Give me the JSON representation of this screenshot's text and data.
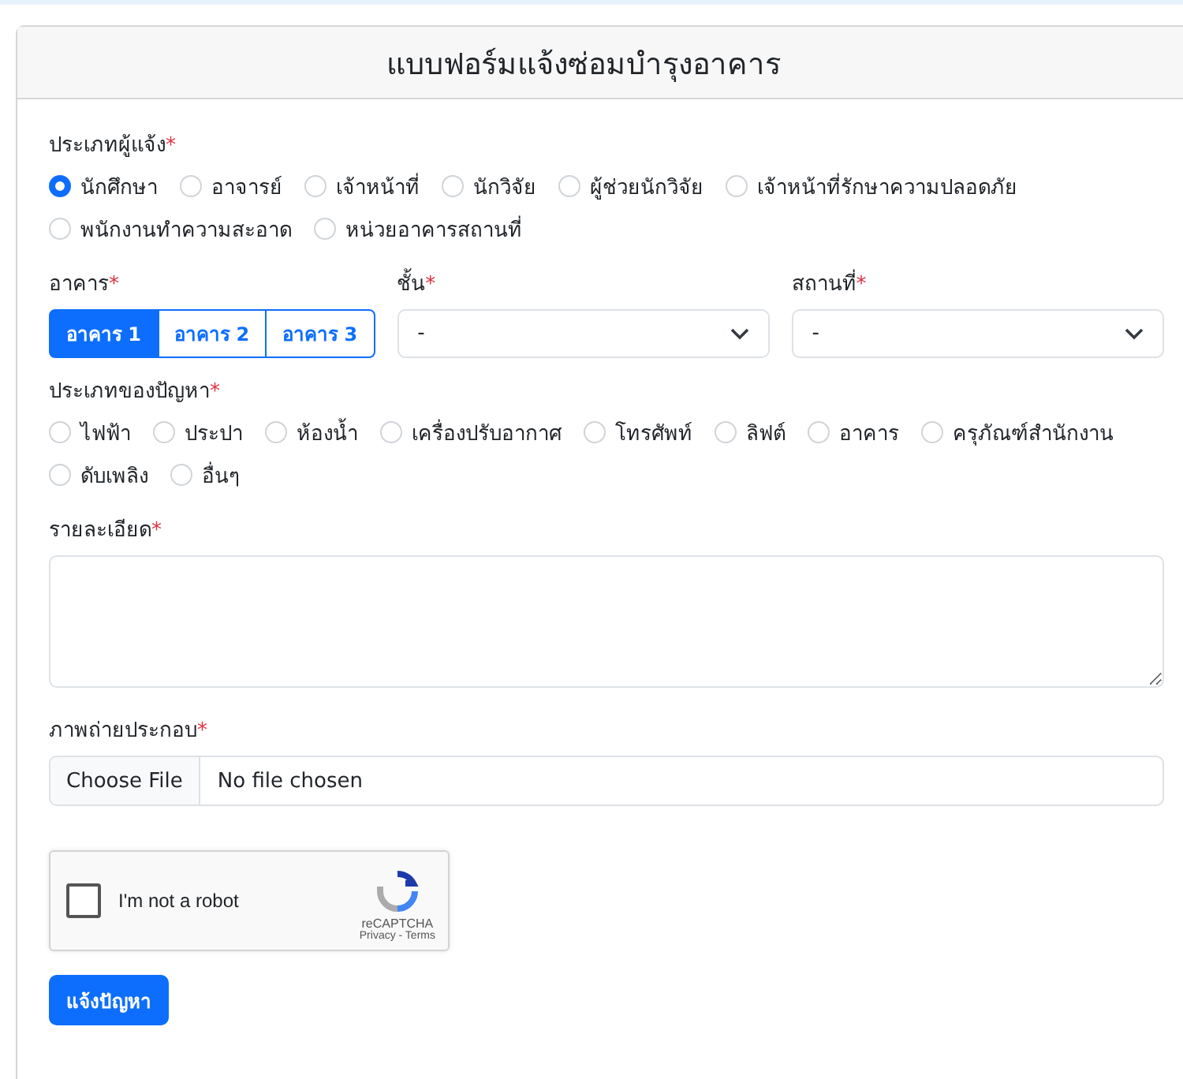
{
  "card": {
    "title": "แบบฟอร์มแจ้งซ่อมบำรุงอาคาร"
  },
  "reporter_type": {
    "label": "ประเภทผู้แจ้ง",
    "mark": "*",
    "options": [
      {
        "label": "นักศึกษา",
        "selected": true
      },
      {
        "label": "อาจารย์",
        "selected": false
      },
      {
        "label": "เจ้าหน้าที่",
        "selected": false
      },
      {
        "label": "นักวิจัย",
        "selected": false
      },
      {
        "label": "ผู้ช่วยนักวิจัย",
        "selected": false
      },
      {
        "label": "เจ้าหน้าที่รักษาความปลอดภัย",
        "selected": false
      },
      {
        "label": "พนักงานทำความสะอาด",
        "selected": false
      },
      {
        "label": "หน่วยอาคารสถานที่",
        "selected": false
      }
    ]
  },
  "building": {
    "label": "อาคาร",
    "mark": "*",
    "options": [
      {
        "label": "อาคาร 1",
        "selected": true
      },
      {
        "label": "อาคาร 2",
        "selected": false
      },
      {
        "label": "อาคาร 3",
        "selected": false
      }
    ]
  },
  "floor": {
    "label": "ชั้น",
    "mark": "*",
    "value": "-"
  },
  "place": {
    "label": "สถานที่",
    "mark": "*",
    "value": "-"
  },
  "problem_type": {
    "label": "ประเภทของปัญหา",
    "mark": "*",
    "options": [
      {
        "label": "ไฟฟ้า",
        "selected": false
      },
      {
        "label": "ประปา",
        "selected": false
      },
      {
        "label": "ห้องน้ำ",
        "selected": false
      },
      {
        "label": "เครื่องปรับอากาศ",
        "selected": false
      },
      {
        "label": "โทรศัพท์",
        "selected": false
      },
      {
        "label": "ลิฟต์",
        "selected": false
      },
      {
        "label": "อาคาร",
        "selected": false
      },
      {
        "label": "ครุภัณฑ์สำนักงาน",
        "selected": false
      },
      {
        "label": "ดับเพลิง",
        "selected": false
      },
      {
        "label": "อื่นๆ",
        "selected": false
      }
    ]
  },
  "details": {
    "label": "รายละเอียด",
    "mark": "*"
  },
  "photo": {
    "label": "ภาพถ่ายประกอบ",
    "mark": "*",
    "button": "Choose File",
    "status": "No file chosen"
  },
  "captcha": {
    "label": "I'm not a robot",
    "checked": false,
    "brand": "reCAPTCHA",
    "links": "Privacy - Terms"
  },
  "submit": "แจ้งปัญหา"
}
